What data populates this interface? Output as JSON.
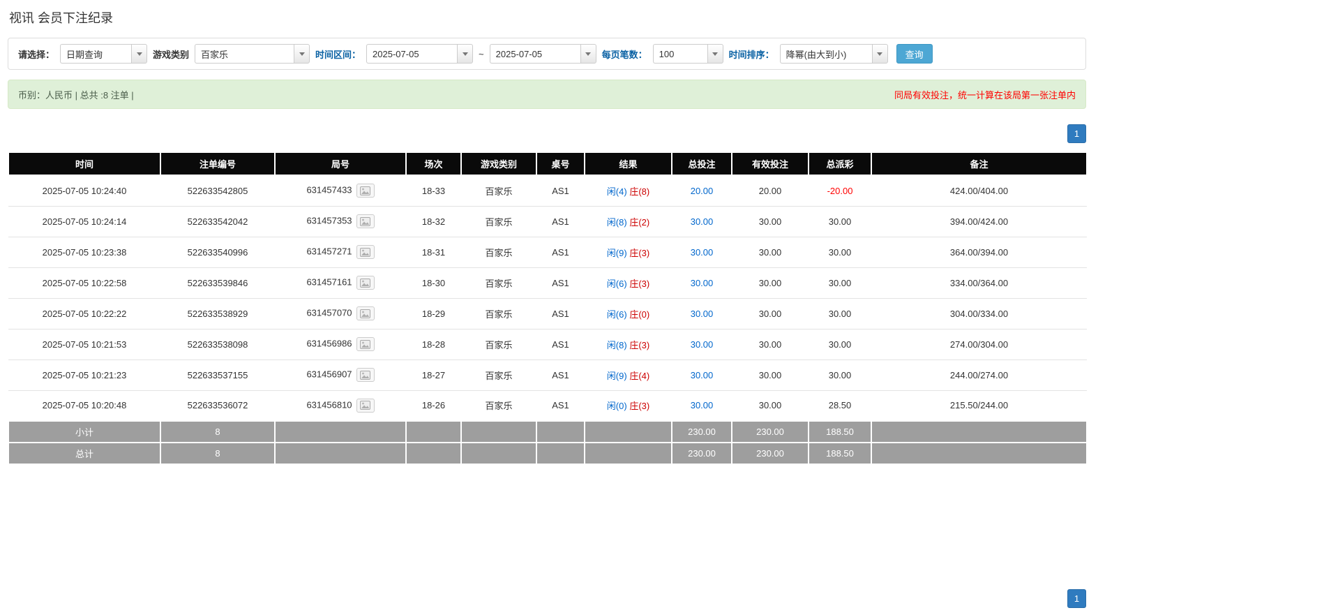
{
  "page": {
    "title": "视讯 会员下注纪录"
  },
  "filters": {
    "select_label": "请选择：",
    "select_value": "日期查询",
    "game_label": "游戏类别",
    "game_value": "百家乐",
    "range_label": "时间区间：",
    "date_from": "2025-07-05",
    "range_separator": "~",
    "date_to": "2025-07-05",
    "page_size_label": "每页笔数：",
    "page_size_value": "100",
    "sort_label": "时间排序：",
    "sort_value": "降幂(由大到小)",
    "search_button": "查询"
  },
  "summary": {
    "left": "币别：人民币 | 总共 :8 注单 |",
    "right": "同局有效投注，统一计算在该局第一张注单内"
  },
  "pagination": {
    "page": "1"
  },
  "table": {
    "headers": [
      "时间",
      "注单编号",
      "局号",
      "场次",
      "游戏类别",
      "桌号",
      "结果",
      "总投注",
      "有效投注",
      "总派彩",
      "备注"
    ],
    "rows": [
      {
        "time": "2025-07-05 10:24:40",
        "bet_id": "522633542805",
        "round_id": "631457433",
        "session": "18-33",
        "game": "百家乐",
        "table": "AS1",
        "result_player": "闲(4)",
        "result_banker": "庄(8)",
        "total_bet": "20.00",
        "valid_bet": "20.00",
        "payout": "-20.00",
        "payout_negative": true,
        "remark": "424.00/404.00"
      },
      {
        "time": "2025-07-05 10:24:14",
        "bet_id": "522633542042",
        "round_id": "631457353",
        "session": "18-32",
        "game": "百家乐",
        "table": "AS1",
        "result_player": "闲(8)",
        "result_banker": "庄(2)",
        "total_bet": "30.00",
        "valid_bet": "30.00",
        "payout": "30.00",
        "payout_negative": false,
        "remark": "394.00/424.00"
      },
      {
        "time": "2025-07-05 10:23:38",
        "bet_id": "522633540996",
        "round_id": "631457271",
        "session": "18-31",
        "game": "百家乐",
        "table": "AS1",
        "result_player": "闲(9)",
        "result_banker": "庄(3)",
        "total_bet": "30.00",
        "valid_bet": "30.00",
        "payout": "30.00",
        "payout_negative": false,
        "remark": "364.00/394.00"
      },
      {
        "time": "2025-07-05 10:22:58",
        "bet_id": "522633539846",
        "round_id": "631457161",
        "session": "18-30",
        "game": "百家乐",
        "table": "AS1",
        "result_player": "闲(6)",
        "result_banker": "庄(3)",
        "total_bet": "30.00",
        "valid_bet": "30.00",
        "payout": "30.00",
        "payout_negative": false,
        "remark": "334.00/364.00"
      },
      {
        "time": "2025-07-05 10:22:22",
        "bet_id": "522633538929",
        "round_id": "631457070",
        "session": "18-29",
        "game": "百家乐",
        "table": "AS1",
        "result_player": "闲(6)",
        "result_banker": "庄(0)",
        "total_bet": "30.00",
        "valid_bet": "30.00",
        "payout": "30.00",
        "payout_negative": false,
        "remark": "304.00/334.00"
      },
      {
        "time": "2025-07-05 10:21:53",
        "bet_id": "522633538098",
        "round_id": "631456986",
        "session": "18-28",
        "game": "百家乐",
        "table": "AS1",
        "result_player": "闲(8)",
        "result_banker": "庄(3)",
        "total_bet": "30.00",
        "valid_bet": "30.00",
        "payout": "30.00",
        "payout_negative": false,
        "remark": "274.00/304.00"
      },
      {
        "time": "2025-07-05 10:21:23",
        "bet_id": "522633537155",
        "round_id": "631456907",
        "session": "18-27",
        "game": "百家乐",
        "table": "AS1",
        "result_player": "闲(9)",
        "result_banker": "庄(4)",
        "total_bet": "30.00",
        "valid_bet": "30.00",
        "payout": "30.00",
        "payout_negative": false,
        "remark": "244.00/274.00"
      },
      {
        "time": "2025-07-05 10:20:48",
        "bet_id": "522633536072",
        "round_id": "631456810",
        "session": "18-26",
        "game": "百家乐",
        "table": "AS1",
        "result_player": "闲(0)",
        "result_banker": "庄(3)",
        "total_bet": "30.00",
        "valid_bet": "30.00",
        "payout": "28.50",
        "payout_negative": false,
        "remark": "215.50/244.00"
      }
    ],
    "subtotal_row": [
      "小计",
      "8",
      "",
      "",
      "",
      "",
      "",
      "230.00",
      "230.00",
      "188.50",
      ""
    ],
    "total_row": [
      "总计",
      "8",
      "",
      "",
      "",
      "",
      "",
      "230.00",
      "230.00",
      "188.50",
      ""
    ]
  },
  "colors": {
    "link_blue": "#0066cc",
    "banker_red": "#cc0000",
    "negative_red": "#ff0000",
    "summary_bg": "#dff0d8",
    "header_bg": "#0a0a0a",
    "sum_row_bg": "#9e9e9e",
    "search_button_bg": "#4da7d4",
    "pager_blue": "#2f7bbf"
  }
}
